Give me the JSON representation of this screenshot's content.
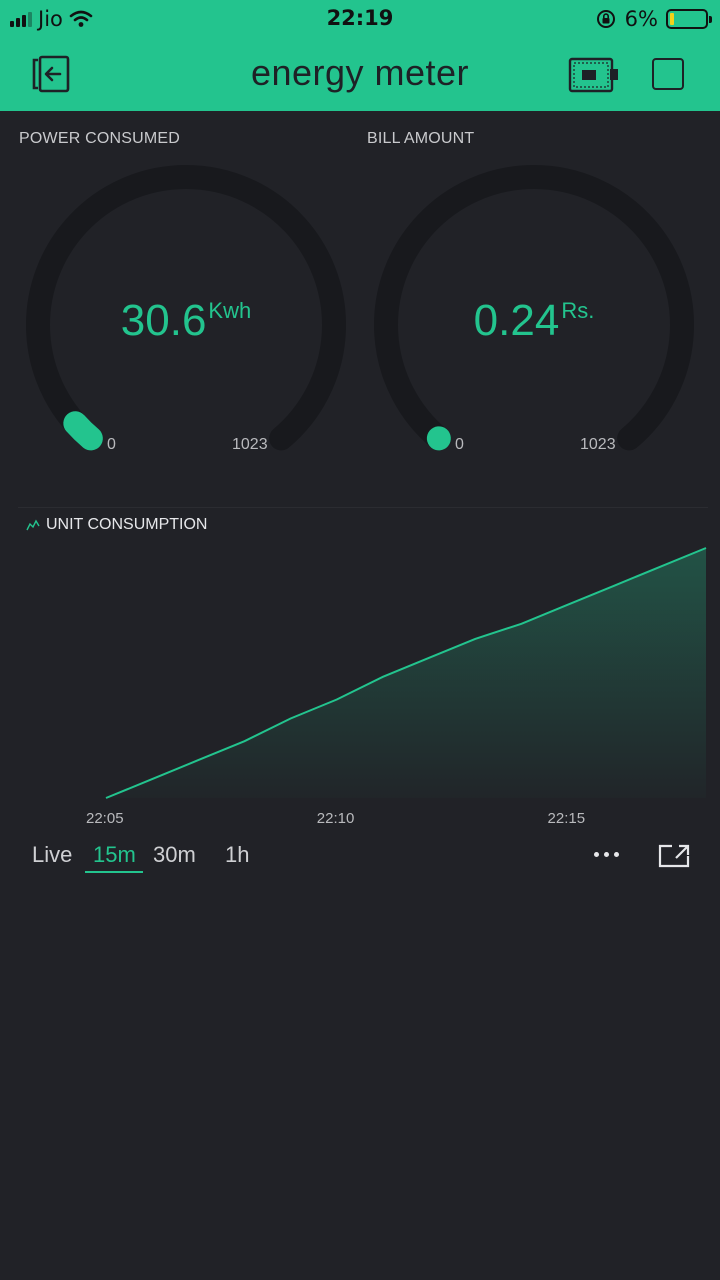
{
  "status_bar": {
    "carrier": "Jio",
    "time": "22:19",
    "battery_percent": "6%",
    "battery_level": 0.06
  },
  "header": {
    "title": "energy meter",
    "icons": {
      "back": "exit-back-icon",
      "device": "device-board-icon",
      "stop": "stop-square-icon"
    }
  },
  "gauges": [
    {
      "label": "POWER CONSUMED",
      "value": "30.6",
      "unit": "Kwh",
      "min": "0",
      "max": "1023",
      "fraction": 0.03
    },
    {
      "label": "BILL AMOUNT",
      "value": "0.24",
      "unit": "Rs.",
      "min": "0",
      "max": "1023",
      "fraction": 0.0
    }
  ],
  "chart": {
    "title": "UNIT CONSUMPTION",
    "icon": "chart-line-icon",
    "accent": "#23c48e"
  },
  "chart_data": {
    "type": "area",
    "title": "UNIT CONSUMPTION",
    "x_ticks": [
      "22:05",
      "22:10",
      "22:15"
    ],
    "x": [
      "22:05",
      "22:06",
      "22:07",
      "22:08",
      "22:09",
      "22:10",
      "22:11",
      "22:12",
      "22:13",
      "22:14",
      "22:15",
      "22:16",
      "22:17",
      "22:18"
    ],
    "series": [
      {
        "values": [
          0,
          2.5,
          5,
          7.5,
          10.5,
          13,
          16,
          18.5,
          21,
          23,
          25.5,
          28,
          30.5,
          33
        ]
      }
    ],
    "ylim": [
      0,
      33
    ],
    "grid": false
  },
  "periods": {
    "items": [
      "Live",
      "15m",
      "30m",
      "1h"
    ],
    "active": "15m"
  },
  "colors": {
    "accent": "#23c48e",
    "background": "#212227",
    "track": "#18191d"
  }
}
